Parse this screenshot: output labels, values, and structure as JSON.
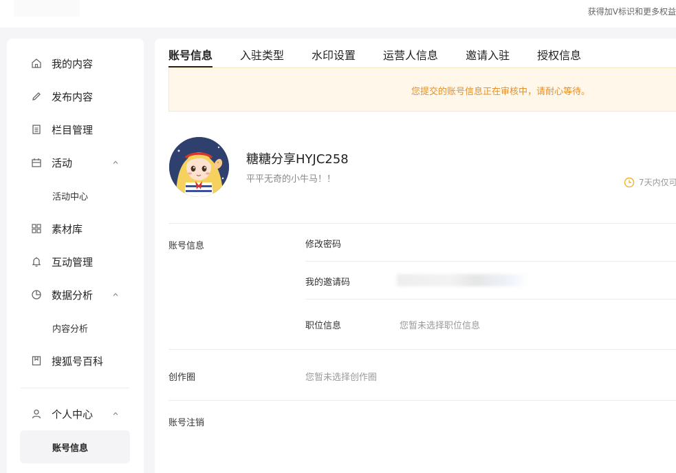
{
  "topbar": {
    "promo_text": "获得加V标识和更多权益"
  },
  "sidebar": {
    "items": [
      {
        "label": "我的内容",
        "icon": "home-icon"
      },
      {
        "label": "发布内容",
        "icon": "pencil-icon"
      },
      {
        "label": "栏目管理",
        "icon": "document-icon"
      },
      {
        "label": "活动",
        "icon": "calendar-icon",
        "expanded": true
      },
      {
        "label": "活动中心",
        "sub": true
      },
      {
        "label": "素材库",
        "icon": "grid-icon"
      },
      {
        "label": "互动管理",
        "icon": "bell-icon"
      },
      {
        "label": "数据分析",
        "icon": "pie-chart-icon",
        "expanded": true
      },
      {
        "label": "内容分析",
        "sub": true
      },
      {
        "label": "搜狐号百科",
        "icon": "bookmark-icon"
      },
      {
        "label": "个人中心",
        "icon": "user-icon",
        "expanded": true
      },
      {
        "label": "账号信息",
        "sub": true,
        "active": true
      }
    ]
  },
  "tabs": [
    {
      "label": "账号信息",
      "active": true
    },
    {
      "label": "入驻类型"
    },
    {
      "label": "水印设置"
    },
    {
      "label": "运营人信息"
    },
    {
      "label": "邀请入驻"
    },
    {
      "label": "授权信息"
    }
  ],
  "notice": {
    "text": "您提交的账号信息正在审核中，请耐心等待。",
    "color": "#e0902f"
  },
  "profile": {
    "name": "糖糖分享HYJC258",
    "bio": "平平无奇的小牛马！！",
    "limit_text": "7天内仅可"
  },
  "account_section": {
    "label": "账号信息",
    "rows": [
      {
        "label": "修改密码",
        "value": ""
      },
      {
        "label": "我的邀请码",
        "value": ""
      },
      {
        "label": "职位信息",
        "value": "您暂未选择职位信息"
      }
    ]
  },
  "creative_circle": {
    "label": "创作圈",
    "value": "您暂未选择创作圈"
  },
  "account_cancel": {
    "label": "账号注销"
  },
  "colors": {
    "accent_warning": "#e0902f",
    "notice_bg": "#fff8ea",
    "clock_icon": "#f0b429"
  }
}
